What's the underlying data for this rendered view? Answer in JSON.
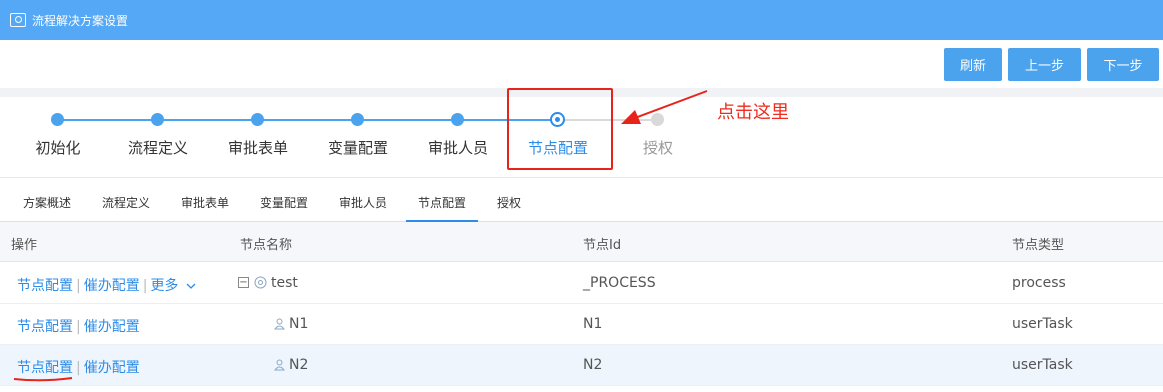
{
  "window": {
    "title": "流程解决方案设置",
    "icon": "settings-window-icon"
  },
  "toolbar": {
    "refresh": "刷新",
    "prev": "上一步",
    "next": "下一步"
  },
  "steps": [
    {
      "label": "初始化",
      "state": "done"
    },
    {
      "label": "流程定义",
      "state": "done"
    },
    {
      "label": "审批表单",
      "state": "done"
    },
    {
      "label": "变量配置",
      "state": "done"
    },
    {
      "label": "审批人员",
      "state": "done"
    },
    {
      "label": "节点配置",
      "state": "current"
    },
    {
      "label": "授权",
      "state": "pending"
    }
  ],
  "annotation": {
    "hint": "点击这里"
  },
  "tabs": [
    {
      "label": "方案概述"
    },
    {
      "label": "流程定义"
    },
    {
      "label": "审批表单"
    },
    {
      "label": "变量配置"
    },
    {
      "label": "审批人员"
    },
    {
      "label": "节点配置",
      "active": true
    },
    {
      "label": "授权"
    }
  ],
  "table": {
    "headers": {
      "op": "操作",
      "name": "节点名称",
      "id": "节点Id",
      "type": "节点类型"
    },
    "rows": [
      {
        "actions": [
          "节点配置",
          "催办配置",
          "更多"
        ],
        "name": "test",
        "id": "_PROCESS",
        "type": "process"
      },
      {
        "actions": [
          "节点配置",
          "催办配置"
        ],
        "name": "N1",
        "id": "N1",
        "type": "userTask"
      },
      {
        "actions": [
          "节点配置",
          "催办配置"
        ],
        "name": "N2",
        "id": "N2",
        "type": "userTask",
        "highlighted": true
      }
    ]
  },
  "colors": {
    "titlebar": "#55a8f5",
    "accent": "#2d8ce8",
    "button": "#4aa3ec",
    "annotation": "#e8231a"
  }
}
